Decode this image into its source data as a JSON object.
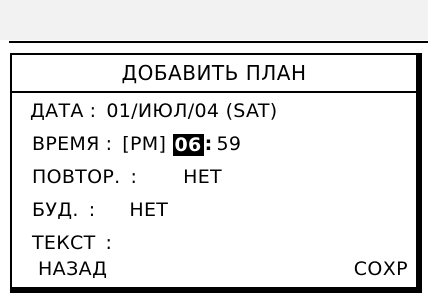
{
  "dialog": {
    "title": "ДОБАВИТЬ ПЛАН",
    "date": {
      "label": "ДАТА",
      "sep": ":",
      "value": "01/ИЮЛ/04 (SAT)"
    },
    "time": {
      "label": "ВРЕМЯ",
      "sep": ":",
      "ampm": "[PM]",
      "hour": "06",
      "colon": ":",
      "minute": "59"
    },
    "repeat": {
      "label": "ПОВТОР.",
      "sep": ":",
      "value": "НЕТ"
    },
    "alarm": {
      "label": "БУД.",
      "sep": ":",
      "value": "НЕТ"
    },
    "text": {
      "label": "ТЕКСТ",
      "sep": ":",
      "value": ""
    }
  },
  "softkeys": {
    "left": "НАЗАД",
    "right": "СОХР"
  }
}
